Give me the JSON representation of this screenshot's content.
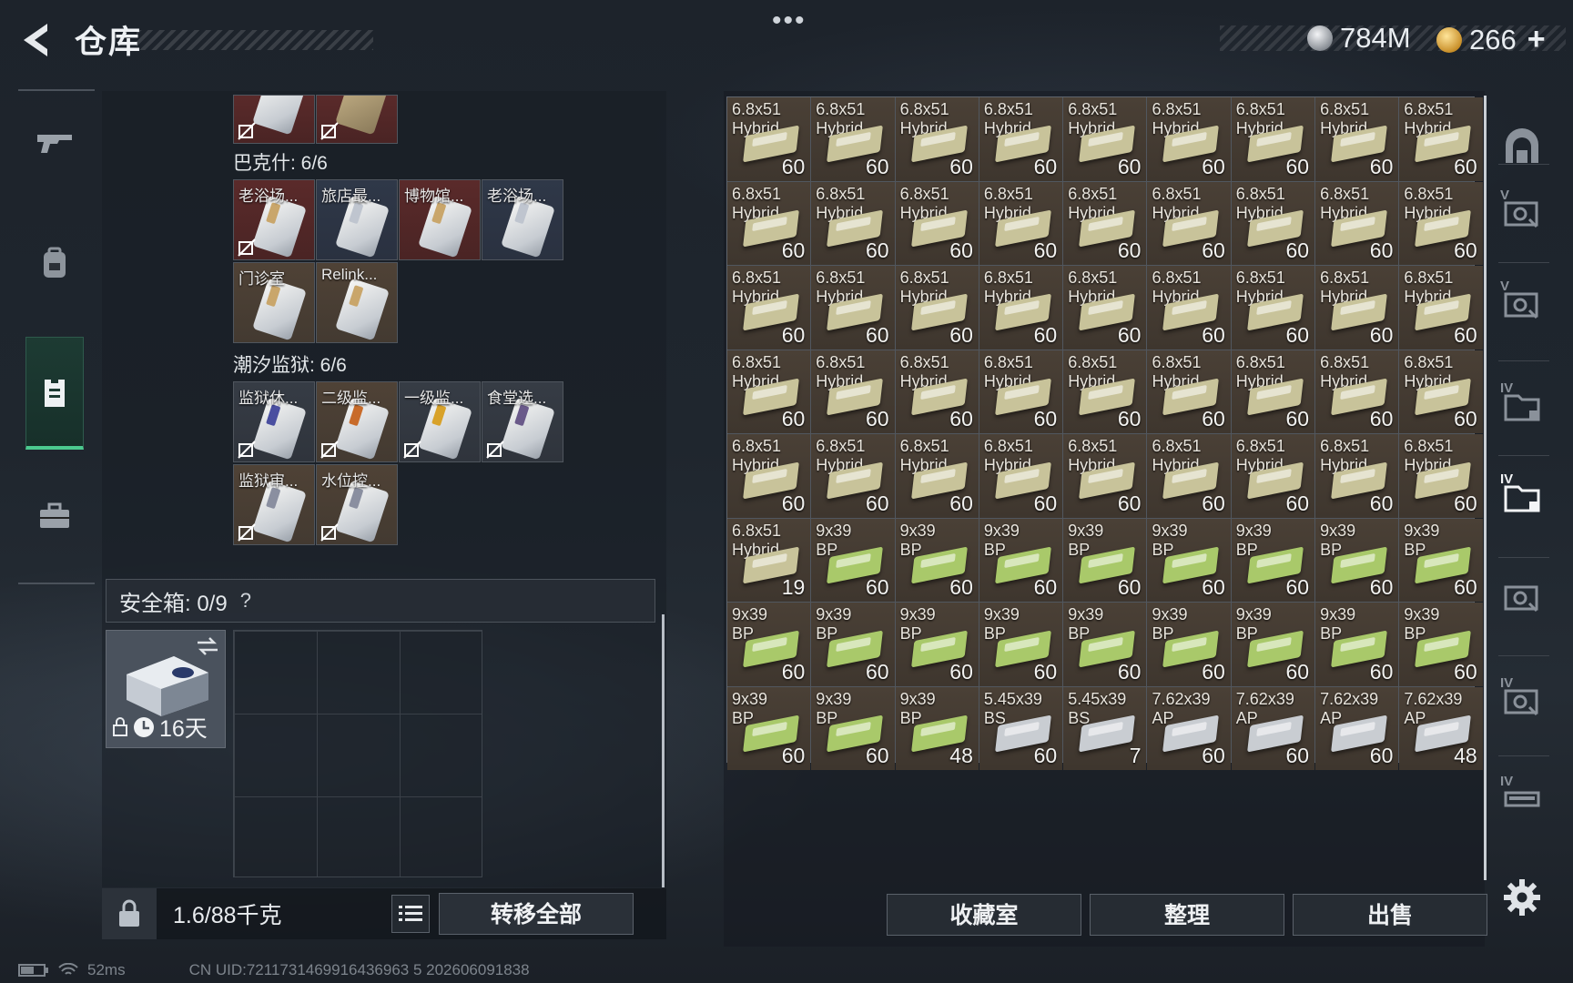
{
  "header": {
    "title": "仓库",
    "currency_silver": "784M",
    "currency_gold": "266",
    "plus": "+",
    "menu_dots": "•••"
  },
  "left_nav": {
    "items": [
      "weapon-icon",
      "backpack-icon",
      "vest-icon",
      "briefcase-icon"
    ],
    "active": 2
  },
  "sections": [
    {
      "label": "巴克什: 6/6"
    },
    {
      "label": "潮汐监狱: 6/6"
    }
  ],
  "bakshi_items": [
    {
      "label": "老浴场...",
      "bg": "red",
      "strip": "#c9a66b"
    },
    {
      "label": "旅店最...",
      "bg": "blue",
      "strip": "#bfc5cf"
    },
    {
      "label": "博物馆...",
      "bg": "red",
      "strip": "#c9a66b"
    },
    {
      "label": "老浴场...",
      "bg": "blue",
      "strip": "#bfc5cf"
    },
    {
      "label": "门诊室",
      "bg": "brown",
      "strip": "#c9a66b"
    },
    {
      "label": "Relink...",
      "bg": "brown",
      "strip": "#c9a66b"
    }
  ],
  "prison_items": [
    {
      "label": "监狱休...",
      "bg": "gray",
      "strip": "#4a4fa0"
    },
    {
      "label": "二级监...",
      "bg": "brown",
      "strip": "#c86b2a"
    },
    {
      "label": "一级监...",
      "bg": "gray",
      "strip": "#d8a22a"
    },
    {
      "label": "食堂选...",
      "bg": "gray",
      "strip": "#6a5a8a"
    },
    {
      "label": "监狱审...",
      "bg": "brown",
      "strip": "#8a8fa0"
    },
    {
      "label": "水位控...",
      "bg": "brown",
      "strip": "#8a8fa0"
    }
  ],
  "safe_box": {
    "label": "安全箱: 0/9",
    "help": "?",
    "duration": "16天"
  },
  "bottom_left": {
    "weight": "1.6/88千克",
    "transfer": "转移全部"
  },
  "grid": {
    "cells": [
      [
        "6.8x51",
        "Hybrid",
        "60",
        "g"
      ],
      [
        "6.8x51",
        "Hybrid",
        "60",
        "g"
      ],
      [
        "6.8x51",
        "Hybrid",
        "60",
        "g"
      ],
      [
        "6.8x51",
        "Hybrid",
        "60",
        "g"
      ],
      [
        "6.8x51",
        "Hybrid",
        "60",
        "g"
      ],
      [
        "6.8x51",
        "Hybrid",
        "60",
        "g"
      ],
      [
        "6.8x51",
        "Hybrid",
        "60",
        "g"
      ],
      [
        "6.8x51",
        "Hybrid",
        "60",
        "g"
      ],
      [
        "6.8x51",
        "Hybrid",
        "60",
        "g"
      ],
      [
        "6.8x51",
        "Hybrid",
        "60",
        "g"
      ],
      [
        "6.8x51",
        "Hybrid",
        "60",
        "g"
      ],
      [
        "6.8x51",
        "Hybrid",
        "60",
        "g"
      ],
      [
        "6.8x51",
        "Hybrid",
        "60",
        "g"
      ],
      [
        "6.8x51",
        "Hybrid",
        "60",
        "g"
      ],
      [
        "6.8x51",
        "Hybrid",
        "60",
        "g"
      ],
      [
        "6.8x51",
        "Hybrid",
        "60",
        "g"
      ],
      [
        "6.8x51",
        "Hybrid",
        "60",
        "g"
      ],
      [
        "6.8x51",
        "Hybrid",
        "60",
        "g"
      ],
      [
        "6.8x51",
        "Hybrid",
        "60",
        "g"
      ],
      [
        "6.8x51",
        "Hybrid",
        "60",
        "g"
      ],
      [
        "6.8x51",
        "Hybrid",
        "60",
        "g"
      ],
      [
        "6.8x51",
        "Hybrid",
        "60",
        "g"
      ],
      [
        "6.8x51",
        "Hybrid",
        "60",
        "g"
      ],
      [
        "6.8x51",
        "Hybrid",
        "60",
        "g"
      ],
      [
        "6.8x51",
        "Hybrid",
        "60",
        "g"
      ],
      [
        "6.8x51",
        "Hybrid",
        "60",
        "g"
      ],
      [
        "6.8x51",
        "Hybrid",
        "60",
        "g"
      ],
      [
        "6.8x51",
        "Hybrid",
        "60",
        "g"
      ],
      [
        "6.8x51",
        "Hybrid",
        "60",
        "g"
      ],
      [
        "6.8x51",
        "Hybrid",
        "60",
        "g"
      ],
      [
        "6.8x51",
        "Hybrid",
        "60",
        "g"
      ],
      [
        "6.8x51",
        "Hybrid",
        "60",
        "g"
      ],
      [
        "6.8x51",
        "Hybrid",
        "60",
        "g"
      ],
      [
        "6.8x51",
        "Hybrid",
        "60",
        "g"
      ],
      [
        "6.8x51",
        "Hybrid",
        "60",
        "g"
      ],
      [
        "6.8x51",
        "Hybrid",
        "60",
        "g"
      ],
      [
        "6.8x51",
        "Hybrid",
        "60",
        "g"
      ],
      [
        "6.8x51",
        "Hybrid",
        "60",
        "g"
      ],
      [
        "6.8x51",
        "Hybrid",
        "60",
        "g"
      ],
      [
        "6.8x51",
        "Hybrid",
        "60",
        "g"
      ],
      [
        "6.8x51",
        "Hybrid",
        "60",
        "g"
      ],
      [
        "6.8x51",
        "Hybrid",
        "60",
        "g"
      ],
      [
        "6.8x51",
        "Hybrid",
        "60",
        "g"
      ],
      [
        "6.8x51",
        "Hybrid",
        "60",
        "g"
      ],
      [
        "6.8x51",
        "Hybrid",
        "60",
        "g"
      ],
      [
        "6.8x51",
        "Hybrid",
        "19",
        "g"
      ],
      [
        "9x39",
        "BP",
        "60",
        "l"
      ],
      [
        "9x39",
        "BP",
        "60",
        "l"
      ],
      [
        "9x39",
        "BP",
        "60",
        "l"
      ],
      [
        "9x39",
        "BP",
        "60",
        "l"
      ],
      [
        "9x39",
        "BP",
        "60",
        "l"
      ],
      [
        "9x39",
        "BP",
        "60",
        "l"
      ],
      [
        "9x39",
        "BP",
        "60",
        "l"
      ],
      [
        "9x39",
        "BP",
        "60",
        "l"
      ],
      [
        "9x39",
        "BP",
        "60",
        "l"
      ],
      [
        "9x39",
        "BP",
        "60",
        "l"
      ],
      [
        "9x39",
        "BP",
        "60",
        "l"
      ],
      [
        "9x39",
        "BP",
        "60",
        "l"
      ],
      [
        "9x39",
        "BP",
        "60",
        "l"
      ],
      [
        "9x39",
        "BP",
        "60",
        "l"
      ],
      [
        "9x39",
        "BP",
        "60",
        "l"
      ],
      [
        "9x39",
        "BP",
        "60",
        "l"
      ],
      [
        "9x39",
        "BP",
        "60",
        "l"
      ],
      [
        "9x39",
        "BP",
        "60",
        "l"
      ],
      [
        "9x39",
        "BP",
        "60",
        "l"
      ],
      [
        "9x39",
        "BP",
        "48",
        "l"
      ],
      [
        "5.45x39",
        "BS",
        "60",
        "s"
      ],
      [
        "5.45x39",
        "BS",
        "7",
        "s"
      ],
      [
        "7.62x39",
        "AP",
        "60",
        "s"
      ],
      [
        "7.62x39",
        "AP",
        "60",
        "s"
      ],
      [
        "7.62x39",
        "AP",
        "60",
        "s"
      ],
      [
        "7.62x39",
        "AP",
        "48",
        "s"
      ]
    ],
    "box_colors": {
      "g": "#c8c39a",
      "l": "#a9c96a",
      "s": "#c9cdd2"
    }
  },
  "right_nav": [
    {
      "icon": "safehouse-icon",
      "tier": ""
    },
    {
      "icon": "case-v-icon",
      "tier": "V"
    },
    {
      "icon": "case-v2-icon",
      "tier": "V"
    },
    {
      "icon": "folder-iv-icon",
      "tier": "IV"
    },
    {
      "icon": "folder-iv-active-icon",
      "tier": "IV"
    },
    {
      "icon": "case-v3-icon",
      "tier": ""
    },
    {
      "icon": "case-iv-icon",
      "tier": "IV"
    },
    {
      "icon": "gun-case-iv-icon",
      "tier": "IV"
    }
  ],
  "bottom_buttons": {
    "collection": "收藏室",
    "sort": "整理",
    "sell": "出售"
  },
  "status": {
    "ping": "52ms",
    "uid": "CN UID:7211731469916436963 5 202606091838"
  }
}
